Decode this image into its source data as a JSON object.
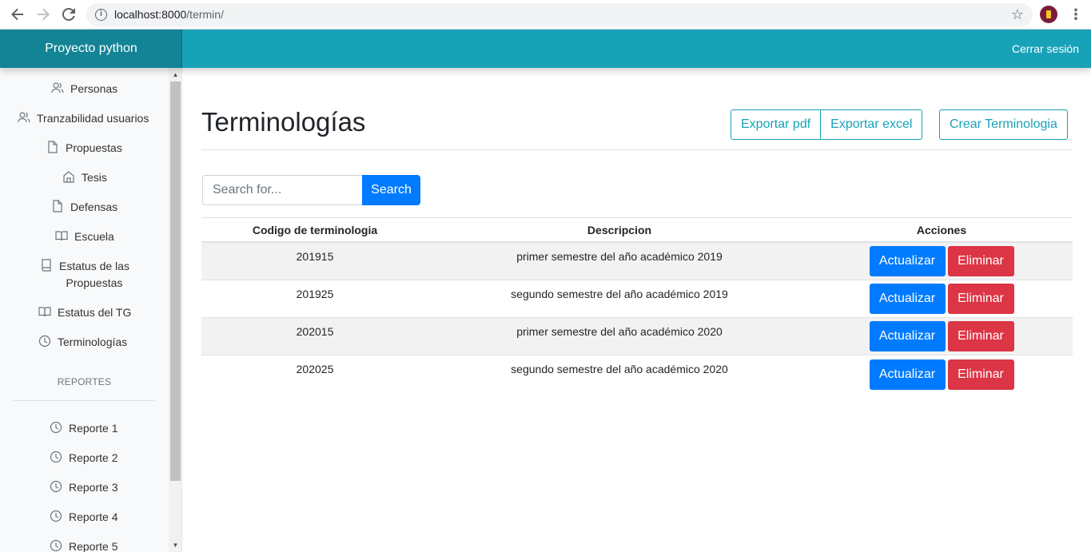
{
  "browser": {
    "url_host": "localhost:8000",
    "url_path": "/termin/"
  },
  "navbar": {
    "brand": "Proyecto python",
    "signout": "Cerrar sesión",
    "color": "#17a2b8"
  },
  "sidebar": {
    "items": [
      {
        "label": "Personas",
        "icon": "people-icon"
      },
      {
        "label": "Tranzabilidad usuarios",
        "icon": "people-icon"
      },
      {
        "label": "Propuestas",
        "icon": "file-icon"
      },
      {
        "label": "Tesis",
        "icon": "home-icon"
      },
      {
        "label": "Defensas",
        "icon": "file-icon"
      },
      {
        "label": "Escuela",
        "icon": "book-open-icon"
      },
      {
        "label_line1": "Estatus de las",
        "label_line2": "Propuestas",
        "icon": "book-icon"
      },
      {
        "label": "Estatus del TG",
        "icon": "book-open-icon"
      },
      {
        "label": "Terminologías",
        "icon": "clock-icon"
      }
    ],
    "reports_heading": "REPORTES",
    "reports": [
      {
        "label": "Reporte 1",
        "icon": "clock-icon"
      },
      {
        "label": "Reporte 2",
        "icon": "clock-icon"
      },
      {
        "label": "Reporte 3",
        "icon": "clock-icon"
      },
      {
        "label": "Reporte 4",
        "icon": "clock-icon"
      },
      {
        "label": "Reporte 5",
        "icon": "clock-icon"
      }
    ]
  },
  "main": {
    "title": "Terminologías",
    "export_pdf": "Exportar pdf",
    "export_excel": "Exportar excel",
    "create": "Crear Terminologia",
    "search_placeholder": "Search for...",
    "search_button": "Search",
    "table": {
      "headers": [
        "Codigo de terminologia",
        "Descripcion",
        "Acciones"
      ],
      "rows": [
        {
          "code": "201915",
          "desc": "primer semestre del año académico 2019"
        },
        {
          "code": "201925",
          "desc": "segundo semestre del año académico 2019"
        },
        {
          "code": "202015",
          "desc": "primer semestre del año académico 2020"
        },
        {
          "code": "202025",
          "desc": "segundo semestre del año académico 2020"
        }
      ],
      "update_label": "Actualizar",
      "delete_label": "Eliminar"
    }
  }
}
